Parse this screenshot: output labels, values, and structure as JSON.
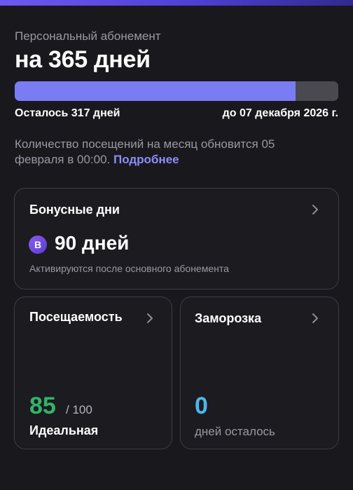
{
  "subscription": {
    "subtitle": "Персональный абонемент",
    "title": "на 365 дней",
    "progress_fraction": 0.868,
    "remaining_text": "Осталось 317 дней",
    "until_text": "до 07 декабря 2026 г.",
    "notice_text": "Количество посещений на месяц обновится 05 февраля в 00:00.",
    "more_link": "Подробнее"
  },
  "bonus_card": {
    "title": "Бонусные дни",
    "badge_letter": "B",
    "value": "90 дней",
    "note": "Активируются после основного абонемента"
  },
  "attendance_card": {
    "title": "Посещаемость",
    "score": "85",
    "max": "/ 100",
    "label": "Идеальная"
  },
  "freeze_card": {
    "title": "Заморозка",
    "value": "0",
    "label": "дней осталось"
  },
  "colors": {
    "accent": "#7a7cf3",
    "score_green": "#34b36a",
    "freeze_blue": "#4fb6ea"
  }
}
